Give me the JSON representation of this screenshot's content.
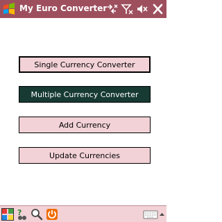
{
  "window": {
    "title": "My Euro Converter",
    "title_bar_color": "#9e4f5e"
  },
  "status_icons": [
    "connectivity-icon",
    "signal-off-icon",
    "volume-muted-icon",
    "close-icon"
  ],
  "buttons": [
    {
      "label": "Single Currency Converter",
      "state": "focused"
    },
    {
      "label": "Multiple Currency Converter",
      "state": "selected"
    },
    {
      "label": "Add Currency",
      "state": "normal"
    },
    {
      "label": "Update Currencies",
      "state": "normal"
    }
  ],
  "colors": {
    "button_bg": "#f2d2d6",
    "selected_bg": "#173a33",
    "taskbar_bg": "#f2d2d6"
  },
  "taskbar_icons": [
    "start-colors-icon",
    "help-search-icon",
    "find-icon",
    "power-icon",
    "keyboard-icon"
  ]
}
